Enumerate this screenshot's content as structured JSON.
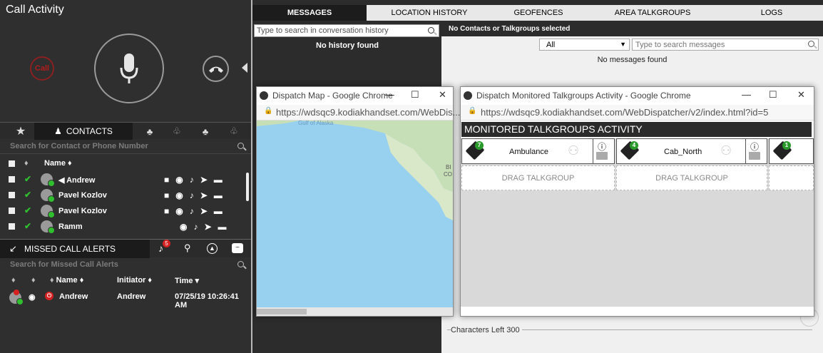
{
  "call_activity": {
    "title": "Call Activity",
    "end_label": "Call"
  },
  "contacts": {
    "tab_label": "CONTACTS",
    "search_placeholder": "Search for Contact or Phone Number",
    "name_header": "Name ♦",
    "rows": [
      {
        "name": "Andrew",
        "actions": "■◉♪➤▬"
      },
      {
        "name": "Pavel Kozlov",
        "actions": "■◉♪➤▬"
      },
      {
        "name": "Pavel Kozlov",
        "actions": "■◉♪➤▬"
      },
      {
        "name": "Ramm",
        "actions": "◉♪➤▬"
      }
    ]
  },
  "missed_call_alerts": {
    "tab_label": "MISSED CALL ALERTS",
    "badge": "5",
    "search_placeholder": "Search for Missed Call Alerts",
    "headers": {
      "name": "Name ♦",
      "initiator": "Initiator ♦",
      "time": "Time ▾"
    },
    "rows": [
      {
        "name": "Andrew",
        "initiator": "Andrew",
        "time": "07/25/19 10:26:41 AM"
      }
    ]
  },
  "nav": {
    "tabs": [
      "MESSAGES",
      "LOCATION HISTORY",
      "GEOFENCES",
      "AREA TALKGROUPS",
      "LOGS"
    ],
    "active": "MESSAGES"
  },
  "messages": {
    "conversation_search_placeholder": "Type to search in conversation history",
    "no_history": "No history found",
    "no_selection": "No Contacts or Talkgroups selected",
    "filter_value": "All",
    "message_search_placeholder": "Type to search messages",
    "no_messages": "No messages found",
    "characters_left": "Characters Left 300"
  },
  "map_window": {
    "title": "Dispatch Map - Google Chrome",
    "url": "https://wdsqc9.kodiakhandset.com/WebDis...",
    "label_gulf": "Gulf of Alaska",
    "label_bc": "BI\nCO"
  },
  "talkgroup_window": {
    "title": "Dispatch Monitored Talkgroups Activity - Google Chrome",
    "url": "https://wdsqc9.kodiakhandset.com/WebDispatcher/v2/index.html?id=5",
    "header": "MONITORED TALKGROUPS ACTIVITY",
    "talkgroups": [
      {
        "name": "Ambulance",
        "count": "7"
      },
      {
        "name": "Cab_North",
        "count": "4"
      },
      {
        "name": "",
        "count": "1"
      }
    ],
    "drag_label": "DRAG TALKGROUP"
  },
  "colors": {
    "accent_green": "#2fbf2f",
    "alert_red": "#d42020",
    "dark_bg": "#2f2f2f"
  }
}
